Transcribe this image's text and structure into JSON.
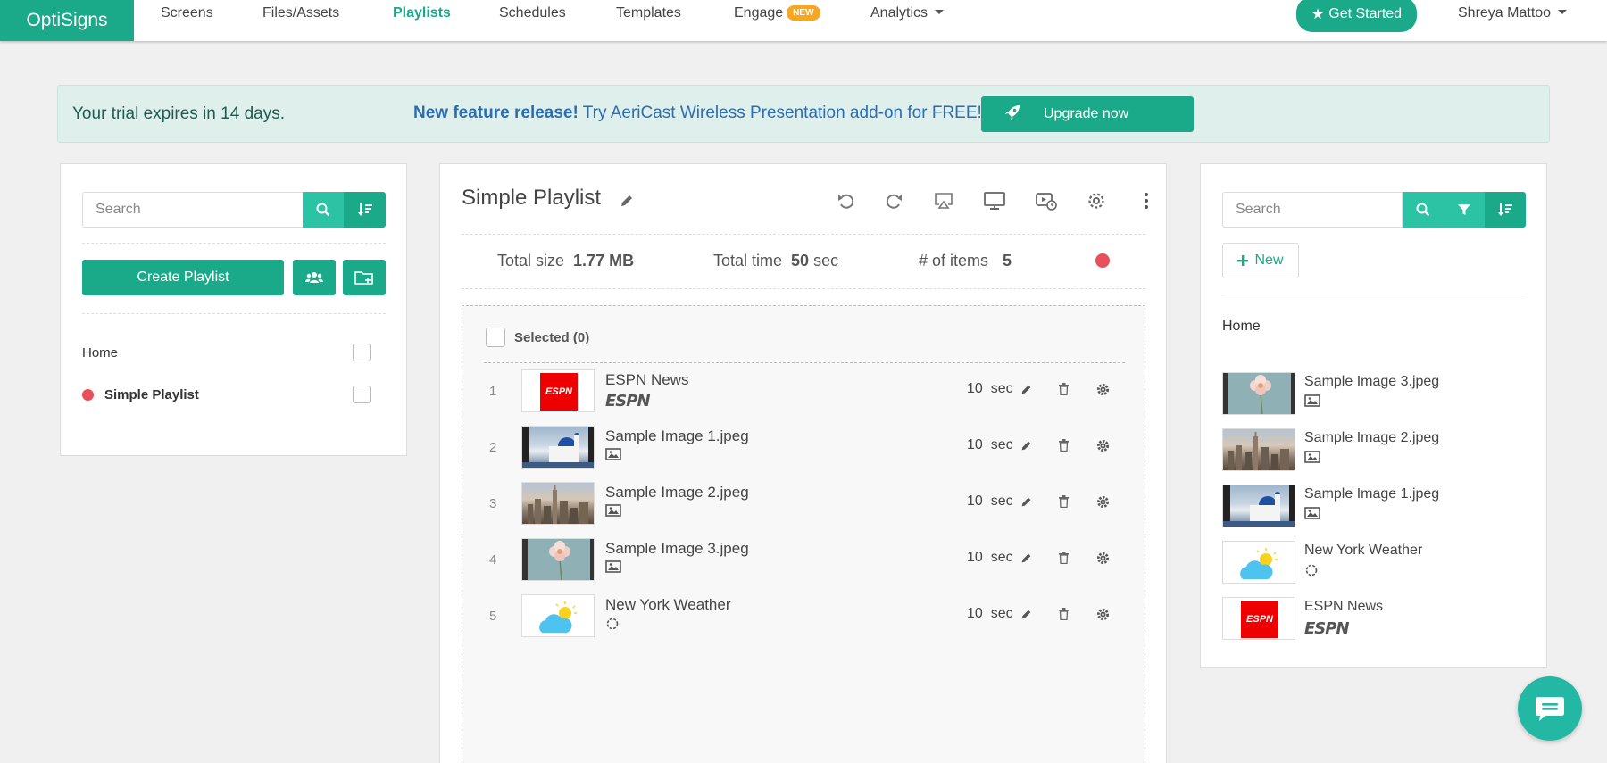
{
  "app": {
    "logo": "OptiSigns"
  },
  "nav": {
    "items": [
      "Screens",
      "Files/Assets",
      "Playlists",
      "Schedules",
      "Templates",
      "Engage",
      "Analytics"
    ],
    "engage_badge": "NEW",
    "get_started": "Get Started",
    "user": "Shreya Mattoo"
  },
  "banner": {
    "trial": "Your trial expires in 14 days.",
    "feature_bold": "New feature release!",
    "feature_text": " Try AeriCast Wireless Presentation add-on for FREE!",
    "upgrade": "Upgrade now"
  },
  "left": {
    "search_placeholder": "Search",
    "create_label": "Create Playlist",
    "tree": [
      {
        "label": "Home",
        "active": false
      },
      {
        "label": "Simple Playlist",
        "active": true
      }
    ]
  },
  "center": {
    "title": "Simple Playlist",
    "stats": {
      "size_label": "Total size",
      "size_value": "1.77 MB",
      "time_label": "Total time",
      "time_value": "50",
      "time_unit": "sec",
      "items_label": "# of items",
      "items_value": "5"
    },
    "selected_label": "Selected (0)",
    "items": [
      {
        "num": "1",
        "name": "ESPN News",
        "kind": "espn",
        "duration": "10",
        "unit": "sec"
      },
      {
        "num": "2",
        "name": "Sample Image 1.jpeg",
        "kind": "image",
        "duration": "10",
        "unit": "sec"
      },
      {
        "num": "3",
        "name": "Sample Image 2.jpeg",
        "kind": "image",
        "duration": "10",
        "unit": "sec"
      },
      {
        "num": "4",
        "name": "Sample Image 3.jpeg",
        "kind": "image",
        "duration": "10",
        "unit": "sec"
      },
      {
        "num": "5",
        "name": "New York Weather",
        "kind": "weather",
        "duration": "10",
        "unit": "sec"
      }
    ]
  },
  "right": {
    "search_placeholder": "Search",
    "new_label": "New",
    "folder": "Home",
    "assets": [
      {
        "name": "Sample Image 3.jpeg",
        "kind": "image"
      },
      {
        "name": "Sample Image 2.jpeg",
        "kind": "image"
      },
      {
        "name": "Sample Image 1.jpeg",
        "kind": "image"
      },
      {
        "name": "New York Weather",
        "kind": "weather"
      },
      {
        "name": "ESPN News",
        "kind": "espn"
      }
    ]
  },
  "espn_logo_text": "ESPN",
  "colors": {
    "accent": "#1aaa8a",
    "accent_light": "#2bc3a3",
    "banner_bg": "#dff0ec",
    "link": "#2a6db3",
    "badge": "#f6a623",
    "red_dot": "#e8505b"
  }
}
